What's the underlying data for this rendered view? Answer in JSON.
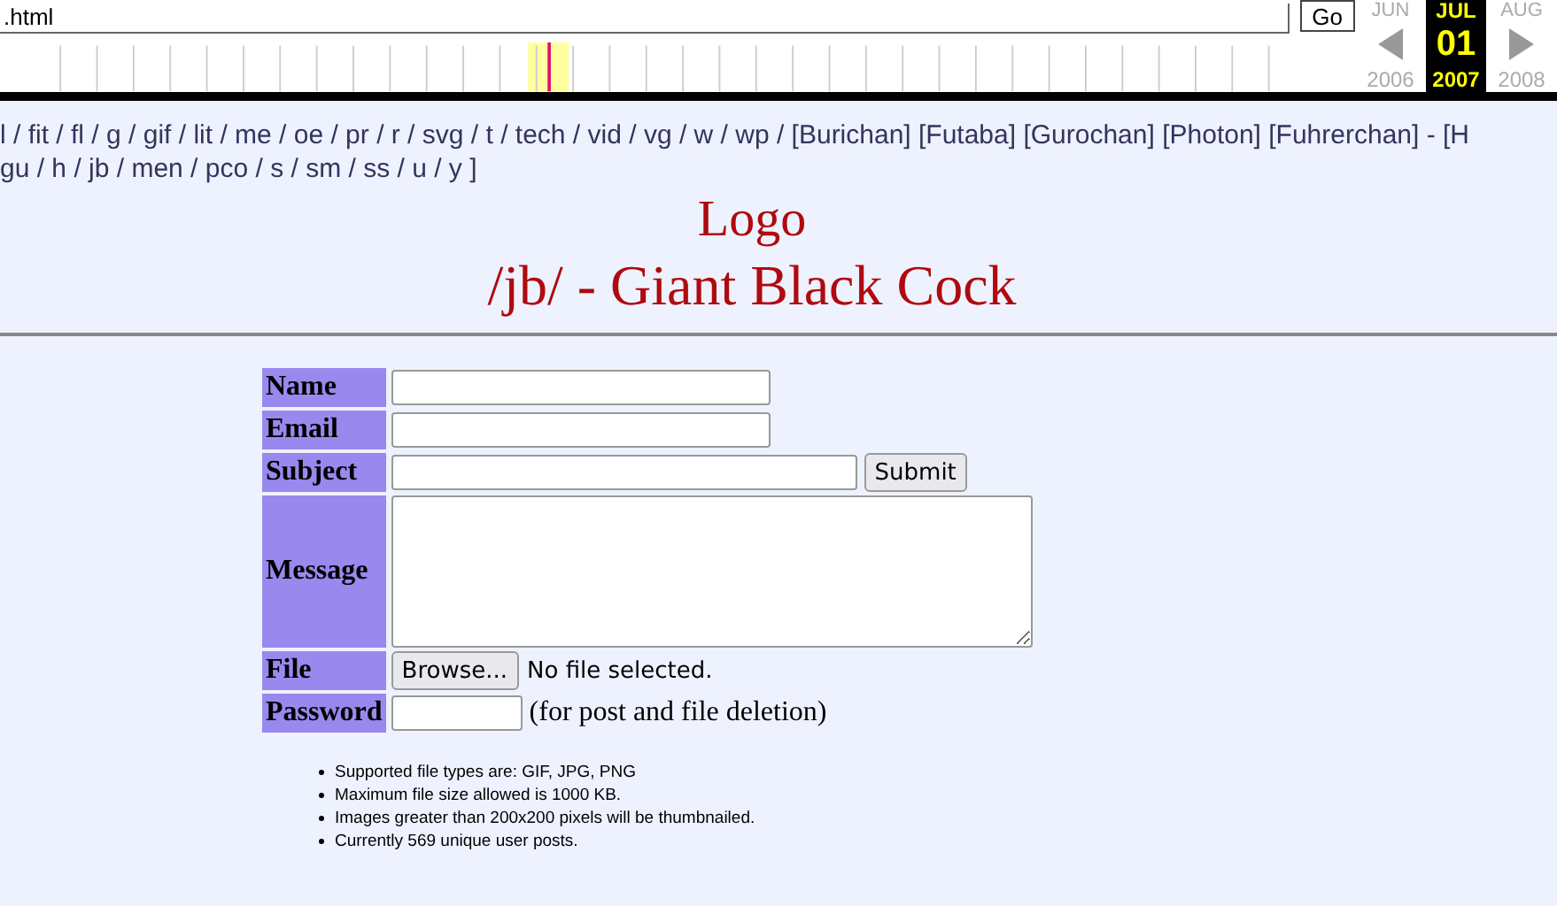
{
  "toolbar": {
    "url": ".html",
    "go_button": "Go",
    "months": [
      {
        "label": "JUN",
        "selected": false
      },
      {
        "label": "JUL",
        "selected": true
      },
      {
        "label": "AUG",
        "selected": false
      }
    ],
    "day": "01",
    "years": [
      {
        "label": "2006",
        "selected": false
      },
      {
        "label": "2007",
        "selected": true
      },
      {
        "label": "2008",
        "selected": false
      }
    ]
  },
  "nav": {
    "lines": [
      "l / fit / fl / g / gif / lit / me / oe / pr / r / svg / t / tech / vid / vg / w / wp /  [Burichan] [Futaba] [Gurochan] [Photon] [Fuhrerchan] - [H",
      "gu / h / jb / men / pco / s / sm / ss / u / y ]"
    ]
  },
  "logo": "Logo",
  "board_title": "/jb/ - Giant Black Cock",
  "form": {
    "rows": [
      {
        "kind": "text",
        "label": "Name"
      },
      {
        "kind": "text",
        "label": "Email"
      },
      {
        "kind": "subject",
        "label": "Subject",
        "button": "Submit"
      },
      {
        "kind": "textarea",
        "label": "Message"
      },
      {
        "kind": "file",
        "label": "File",
        "button": "Browse...",
        "status": "No file selected."
      },
      {
        "kind": "password",
        "label": "Password",
        "note": "(for post and file deletion)"
      }
    ]
  },
  "rules": [
    "Supported file types are: GIF, JPG, PNG",
    "Maximum file size allowed is 1000 KB.",
    "Images greater than 200x200 pixels will be thumbnailed.",
    "Currently 569 unique user posts."
  ]
}
